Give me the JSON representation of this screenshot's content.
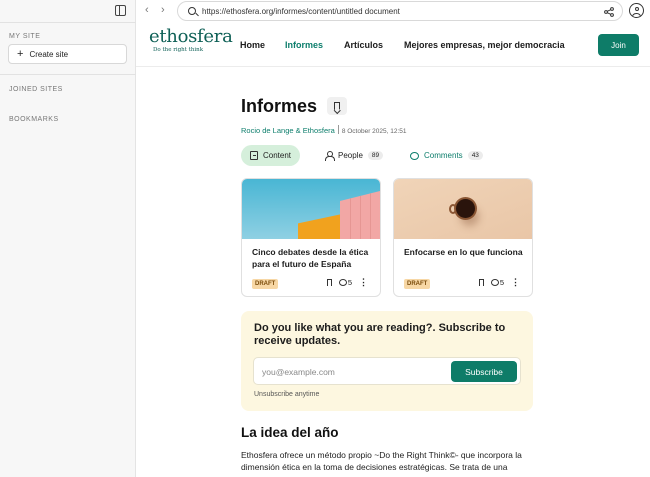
{
  "sidebar": {
    "my_site_label": "MY SITE",
    "create_site_label": "Create site",
    "joined_sites_label": "JOINED SITES",
    "bookmarks_label": "BOOKMARKS"
  },
  "browser": {
    "url": "https://ethosfera.org/informes/content/untitled document"
  },
  "site": {
    "logo_text": "ethosfera",
    "logo_tagline": "Do the right think",
    "nav": [
      "Home",
      "Informes",
      "Artículos",
      "Mejores empresas, mejor democracia"
    ],
    "active_nav": "Informes",
    "join_label": "Join",
    "brand_color": "#0e7c68"
  },
  "page": {
    "title": "Informes",
    "authors": "Rocio de Lange & Ethosfera",
    "date": "8 October 2025, 12:51",
    "tabs": {
      "content": {
        "label": "Content"
      },
      "people": {
        "label": "People",
        "count": "89"
      },
      "comments": {
        "label": "Comments",
        "count": "43"
      }
    }
  },
  "cards": [
    {
      "title": "Cinco debates desde la ética para el futuro de España",
      "status": "DRAFT",
      "comments": "5"
    },
    {
      "title": "Enfocarse en lo que funciona",
      "status": "DRAFT",
      "comments": "5"
    }
  ],
  "subscribe": {
    "heading": "Do you like what you are reading?. Subscribe to receive updates.",
    "placeholder": "you@example.com",
    "button_label": "Subscribe",
    "unsubscribe_label": "Unsubscribe anytime"
  },
  "article": {
    "heading": "La idea del año",
    "body": "Ethosfera ofrece un método propio ~Do the Right Think©- que incorpora la dimensión ética en la toma de decisiones estratégicas. Se trata de una"
  }
}
